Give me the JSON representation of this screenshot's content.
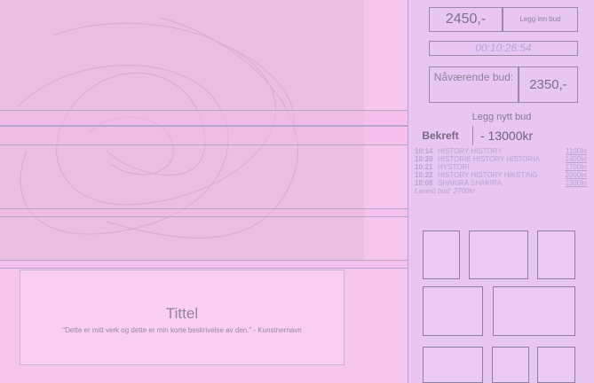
{
  "artwork": {
    "name": "artwork-image"
  },
  "info": {
    "title": "Tittel",
    "quote": "\"Dette er mitt verk og dette er min korte beskrivelse av den.\" - Kunstnernavn"
  },
  "auction": {
    "start_price": "2450,-",
    "place_bid_label": "Legg inn bud",
    "countdown": "00:10:26:54",
    "current_bid_label": "Nåværende bud:",
    "current_bid_value": "2350,-"
  },
  "new_bid": {
    "title": "Legg nytt bud",
    "confirm_label": "Bekreft",
    "input_value": "- 13000kr"
  },
  "history": {
    "rows": [
      {
        "time": "10:14",
        "name": "HISTORY HISTORY",
        "amount": "1100kr"
      },
      {
        "time": "10:20",
        "name": "HISTORIE HISTORY HISTORIA",
        "amount": "1400kr"
      },
      {
        "time": "10:21",
        "name": "HYSTORI",
        "amount": "1700kr"
      },
      {
        "time": "10:22",
        "name": "HISTORY HISTORY HIKSTING",
        "amount": "2000kr"
      },
      {
        "time": "10:08",
        "name": "SHAKIRA SHAKIRA",
        "amount": "2300kr"
      }
    ],
    "lowest_bid": "Lavest bud: 2700kr"
  },
  "colors": {
    "background": "#f7c6ee",
    "panel": "#e9c5f2",
    "border": "#9a8aa8",
    "history_text": "#b8a4d4"
  }
}
